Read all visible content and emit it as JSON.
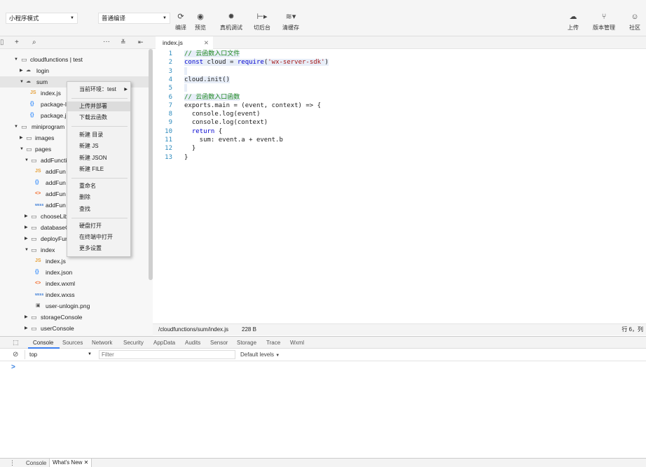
{
  "toolbar": {
    "mode_select": "小程序模式",
    "compile_select": "普通编译",
    "buttons": [
      {
        "label": "编译",
        "icon": "refresh-icon"
      },
      {
        "label": "预览",
        "icon": "eye-icon"
      },
      {
        "label": "真机调试",
        "icon": "bug-icon"
      },
      {
        "label": "切后台",
        "icon": "switch-background-icon"
      },
      {
        "label": "清缓存",
        "icon": "layers-icon"
      }
    ],
    "right_buttons": [
      {
        "label": "上传",
        "icon": "cloud-upload-icon"
      },
      {
        "label": "版本管理",
        "icon": "branch-icon"
      },
      {
        "label": "社区",
        "icon": "chat-icon"
      }
    ]
  },
  "file_toolbar": {
    "add": "+",
    "more": "···"
  },
  "tree": {
    "items": [
      {
        "label": "cloudfunctions | test",
        "icon": "cloud-folder-icon"
      },
      {
        "label": "login",
        "icon": "cloud-icon"
      },
      {
        "label": "sum",
        "icon": "cloud-icon"
      },
      {
        "label": "index.js",
        "icon": "js-file-icon"
      },
      {
        "label": "package-l",
        "icon": "json-file-icon"
      },
      {
        "label": "package.j",
        "icon": "json-file-icon"
      },
      {
        "label": "miniprogram",
        "icon": "folder-icon"
      },
      {
        "label": "images",
        "icon": "folder-icon"
      },
      {
        "label": "pages",
        "icon": "folder-icon"
      },
      {
        "label": "addFuncti",
        "icon": "folder-icon"
      },
      {
        "label": "addFun",
        "icon": "js-file-icon"
      },
      {
        "label": "addFun",
        "icon": "json-file-icon"
      },
      {
        "label": "addFun",
        "icon": "wxml-file-icon"
      },
      {
        "label": "addFun",
        "icon": "wxss-file-icon"
      },
      {
        "label": "chooseLib",
        "icon": "folder-icon"
      },
      {
        "label": "databaseG",
        "icon": "folder-icon"
      },
      {
        "label": "deployFun",
        "icon": "folder-icon"
      },
      {
        "label": "index",
        "icon": "folder-icon"
      },
      {
        "label": "index.js",
        "icon": "js-file-icon"
      },
      {
        "label": "index.json",
        "icon": "json-file-icon"
      },
      {
        "label": "index.wxml",
        "icon": "wxml-file-icon"
      },
      {
        "label": "index.wxss",
        "icon": "wxss-file-icon"
      },
      {
        "label": "user-unlogin.png",
        "icon": "image-file-icon"
      },
      {
        "label": "storageConsole",
        "icon": "folder-icon"
      },
      {
        "label": "userConsole",
        "icon": "folder-icon"
      }
    ]
  },
  "context_menu": {
    "items": [
      "当前环境：test",
      "上传并部署",
      "下载云函数",
      "新建 目录",
      "新建 JS",
      "新建 JSON",
      "新建 FILE",
      "重命名",
      "删除",
      "查找",
      "硬盘打开",
      "在终端中打开",
      "更多设置"
    ]
  },
  "editor": {
    "tab_label": "index.js",
    "line_numbers": [
      "1",
      "2",
      "3",
      "4",
      "5",
      "6",
      "7",
      "8",
      "9",
      "10",
      "11",
      "12",
      "13"
    ],
    "code": {
      "l1": "// 云函数入口文件",
      "l2_kw": "const",
      "l2_a": " cloud = ",
      "l2_kw2": "require",
      "l2_b": "(",
      "l2_str": "'wx-server-sdk'",
      "l2_c": ")",
      "l4": "cloud.init()",
      "l6": "// 云函数入口函数",
      "l7": "exports.main = (event, context) => {",
      "l8": "  console.log(event)",
      "l9": "  console.log(context)",
      "l10_kw": "  return",
      "l10_b": " {",
      "l11": "    sum: event.a + event.b",
      "l12": "  }",
      "l13": "}"
    }
  },
  "status_bar": {
    "path": "/cloudfunctions/sum/index.js",
    "size": "228 B",
    "position": "行 6，列"
  },
  "devtools": {
    "tabs": [
      "Console",
      "Sources",
      "Network",
      "Security",
      "AppData",
      "Audits",
      "Sensor",
      "Storage",
      "Trace",
      "Wxml"
    ],
    "context": "top",
    "filter_placeholder": "Filter",
    "levels": "Default levels",
    "prompt": ">"
  },
  "bottom_tabs": [
    "Console",
    "What's New"
  ]
}
